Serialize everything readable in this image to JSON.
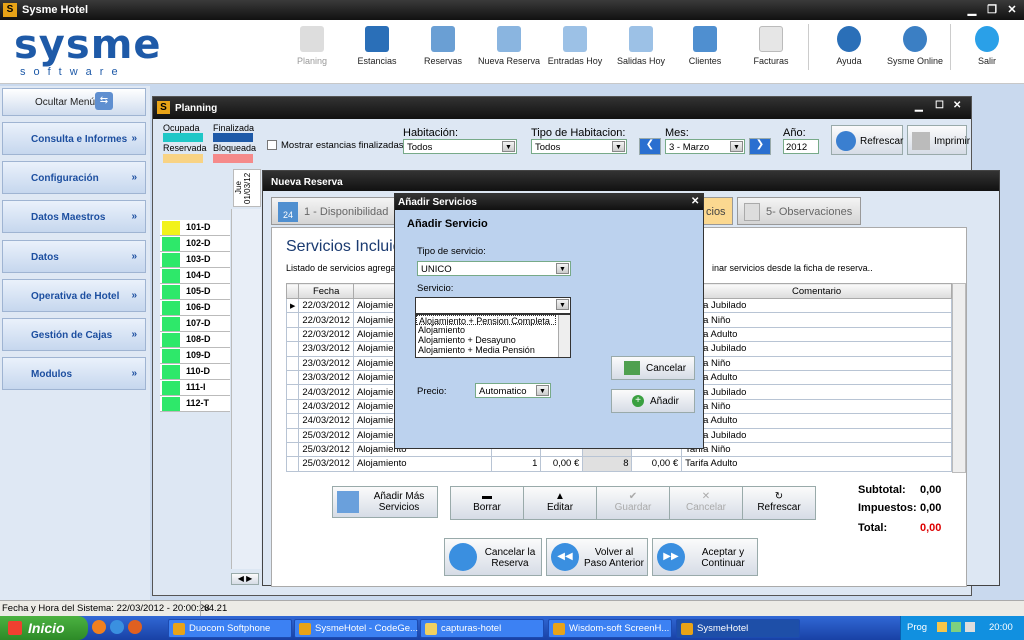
{
  "app": {
    "title": "Sysme Hotel",
    "icon_letter": "S"
  },
  "logo": {
    "main": "sysme",
    "sub": "software"
  },
  "toolbar": [
    {
      "label": "Planing",
      "icon": "calendar-icon",
      "disabled": true
    },
    {
      "label": "Estancias",
      "icon": "bed-icon"
    },
    {
      "label": "Reservas",
      "icon": "drawer-icon"
    },
    {
      "label": "Nueva Reserva",
      "icon": "new-booking-icon"
    },
    {
      "label": "Entradas Hoy",
      "icon": "checkin-icon"
    },
    {
      "label": "Salidas Hoy",
      "icon": "checkout-icon"
    },
    {
      "label": "Clientes",
      "icon": "clients-icon"
    },
    {
      "label": "Facturas",
      "icon": "invoice-icon"
    },
    {
      "label": "Ayuda",
      "icon": "help-icon"
    },
    {
      "label": "Sysme Online",
      "icon": "globe-icon"
    },
    {
      "label": "Salir",
      "icon": "power-icon"
    }
  ],
  "sidebar": {
    "hide_label": "Ocultar Menú",
    "items": [
      "Consulta e Informes",
      "Configuración",
      "Datos Maestros",
      "Datos",
      "Operativa de Hotel",
      "Gestión de Cajas",
      "Modulos"
    ]
  },
  "planning": {
    "title": "Planning",
    "legend": {
      "ocupada": "Ocupada",
      "finalizada": "Finalizada",
      "reservada": "Reservada",
      "bloqueada": "Bloqueada"
    },
    "colors": {
      "ocupada": "#1fc7c7",
      "finalizada": "#1e5aa8",
      "reservada": "#f8d384",
      "bloqueada": "#f58a8a"
    },
    "show_finished": "Mostrar estancias finalizadas",
    "habitacion_label": "Habitación:",
    "habitacion_value": "Todos",
    "tipo_label": "Tipo de Habitacion:",
    "tipo_value": "Todos",
    "mes_label": "Mes:",
    "mes_value": "3 - Marzo",
    "anio_label": "Año:",
    "anio_value": "2012",
    "refresh": "Refrescar",
    "print": "Imprimir",
    "day_header": "Jue 01/03/12",
    "rooms": [
      "101-D",
      "102-D",
      "103-D",
      "104-D",
      "105-D",
      "106-D",
      "107-D",
      "108-D",
      "109-D",
      "110-D",
      "111-I",
      "112-T"
    ]
  },
  "reserva": {
    "title": "Nueva Reserva",
    "tabs": [
      "1 - Disponibilidad",
      "cios",
      "5- Observaciones"
    ],
    "tab_date": "24",
    "heading": "Servicios Incluid",
    "desc_left": "Listado de servicios agregado",
    "desc_right": "inar servicios desde la ficha de reserva..",
    "cols": {
      "fecha": "Fecha",
      "comentario": "Comentario"
    },
    "rows": [
      [
        "22/03/2012",
        "Alojamiento",
        "",
        "",
        "",
        "",
        "Tarifa Jubilado"
      ],
      [
        "22/03/2012",
        "Alojamiento",
        "",
        "",
        "",
        "",
        "Tarifa Niño"
      ],
      [
        "22/03/2012",
        "Alojamiento",
        "",
        "",
        "",
        "",
        "Tarifa Adulto"
      ],
      [
        "23/03/2012",
        "Alojamiento",
        "",
        "",
        "",
        "",
        "Tarifa Jubilado"
      ],
      [
        "23/03/2012",
        "Alojamiento",
        "",
        "",
        "",
        "",
        "Tarifa Niño"
      ],
      [
        "23/03/2012",
        "Alojamiento",
        "",
        "",
        "",
        "",
        "Tarifa Adulto"
      ],
      [
        "24/03/2012",
        "Alojamiento",
        "",
        "",
        "",
        "",
        "Tarifa Jubilado"
      ],
      [
        "24/03/2012",
        "Alojamiento",
        "",
        "",
        "",
        "",
        "Tarifa Niño"
      ],
      [
        "24/03/2012",
        "Alojamiento",
        "",
        "",
        "",
        "",
        "Tarifa Adulto"
      ],
      [
        "25/03/2012",
        "Alojamiento",
        "",
        "",
        "",
        "",
        "Tarifa Jubilado"
      ],
      [
        "25/03/2012",
        "Alojamiento",
        "",
        "",
        "",
        "",
        "Tarifa Niño"
      ],
      [
        "25/03/2012",
        "Alojamiento",
        "1",
        "0,00 €",
        "8",
        "0,00 €",
        "Tarifa Adulto"
      ]
    ],
    "add_more": "Añadir Más Servicios",
    "actions": [
      "Borrar",
      "Editar",
      "Guardar",
      "Cancelar",
      "Refrescar"
    ],
    "subtotal_label": "Subtotal:",
    "subtotal": "0,00",
    "impuestos_label": "Impuestos:",
    "impuestos": "0,00",
    "total_label": "Total:",
    "total": "0,00",
    "nav": [
      "Cancelar la Reserva",
      "Volver al Paso Anterior",
      "Aceptar y Continuar"
    ]
  },
  "dialog": {
    "title": "Añadir Servicios",
    "heading": "Añadir Servicio",
    "tipo_label": "Tipo de servicio:",
    "tipo_value": "UNICO",
    "servicio_label": "Servicio:",
    "servicio_value": "",
    "options": [
      "Alojamiento + Pension Completa",
      "Alojamiento",
      "Alojamiento + Desayuno",
      "Alojamiento + Media Pensión"
    ],
    "precio_label": "Precio:",
    "precio_value": "Automatico",
    "cancel": "Cancelar",
    "add": "Añadir"
  },
  "status": {
    "datetime": "Fecha y Hora del Sistema: 22/03/2012 - 20:00:28",
    "version": "v4.21"
  },
  "taskbar": {
    "start": "Inicio",
    "tasks": [
      "Duocom Softphone",
      "SysmeHotel - CodeGe...",
      "capturas-hotel",
      "Wisdom-soft ScreenH...",
      "SysmeHotel"
    ],
    "tray_label": "Prog",
    "clock": "20:00"
  }
}
